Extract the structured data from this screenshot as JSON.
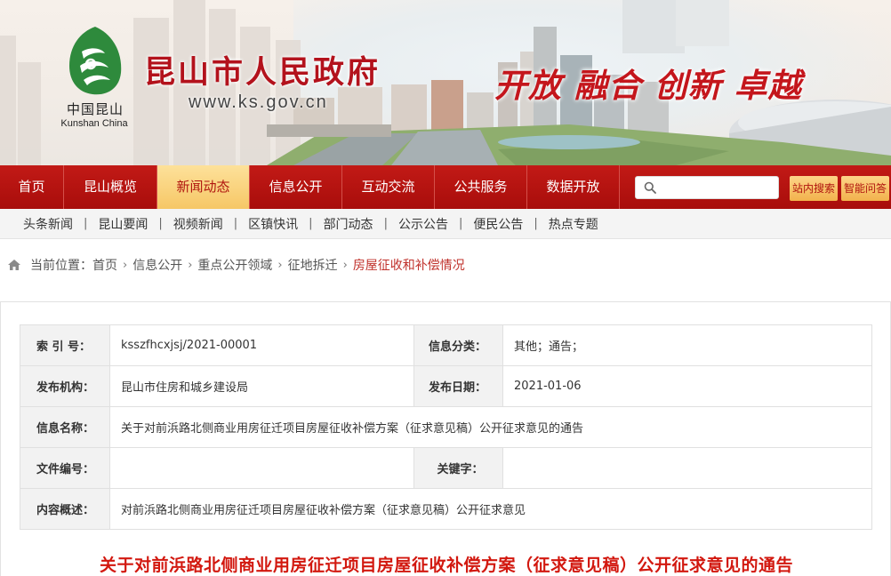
{
  "header": {
    "site_title": "昆山市人民政府",
    "domain": "www.ks.gov.cn",
    "logo_cn": "中国昆山",
    "logo_en": "Kunshan China",
    "slogan": "开放 融合 创新 卓越",
    "colors": {
      "brand_red": "#b3121c",
      "logo_green": "#2e8a3c"
    }
  },
  "main_nav": {
    "items": [
      {
        "label": "首页"
      },
      {
        "label": "昆山概览"
      },
      {
        "label": "新闻动态",
        "active": true
      },
      {
        "label": "信息公开"
      },
      {
        "label": "互动交流"
      },
      {
        "label": "公共服务"
      },
      {
        "label": "数据开放"
      }
    ],
    "search": {
      "placeholder": "",
      "icon": "search-icon"
    },
    "site_search_label": "站内搜索",
    "smart_qa_label": "智能问答",
    "colors": {
      "bar": "#b3140f",
      "active_bg": "#f8cf78"
    }
  },
  "sub_nav": {
    "items": [
      {
        "label": "头条新闻"
      },
      {
        "label": "昆山要闻"
      },
      {
        "label": "视频新闻"
      },
      {
        "label": "区镇快讯"
      },
      {
        "label": "部门动态"
      },
      {
        "label": "公示公告"
      },
      {
        "label": "便民公告"
      },
      {
        "label": "热点专题"
      }
    ],
    "separator": "|"
  },
  "breadcrumb": {
    "prefix": "当前位置：",
    "items": [
      {
        "label": "首页"
      },
      {
        "label": "信息公开"
      },
      {
        "label": "重点公开领域"
      },
      {
        "label": "征地拆迁"
      },
      {
        "label": "房屋征收和补偿情况"
      }
    ],
    "arrow": "›"
  },
  "meta_table": {
    "index_label": "索 引 号：",
    "index_value": "ksszfhcxjsj/2021-00001",
    "category_label": "信息分类：",
    "category_value": "其他；通告；",
    "publisher_label": "发布机构：",
    "publisher_value": "昆山市住房和城乡建设局",
    "date_label": "发布日期：",
    "date_value": "2021-01-06",
    "name_label": "信息名称：",
    "name_value": "关于对前浜路北侧商业用房征迁项目房屋征收补偿方案（征求意见稿）公开征求意见的通告",
    "doc_no_label": "文件编号：",
    "doc_no_value": "",
    "keyword_label": "关键字：",
    "keyword_value": "",
    "summary_label": "内容概述：",
    "summary_value": "对前浜路北侧商业用房征迁项目房屋征收补偿方案（征求意见稿）公开征求意见"
  },
  "article": {
    "title": "关于对前浜路北侧商业用房征迁项目房屋征收补偿方案（征求意见稿）公开征求意见的通告",
    "title_color": "#d2180f"
  }
}
